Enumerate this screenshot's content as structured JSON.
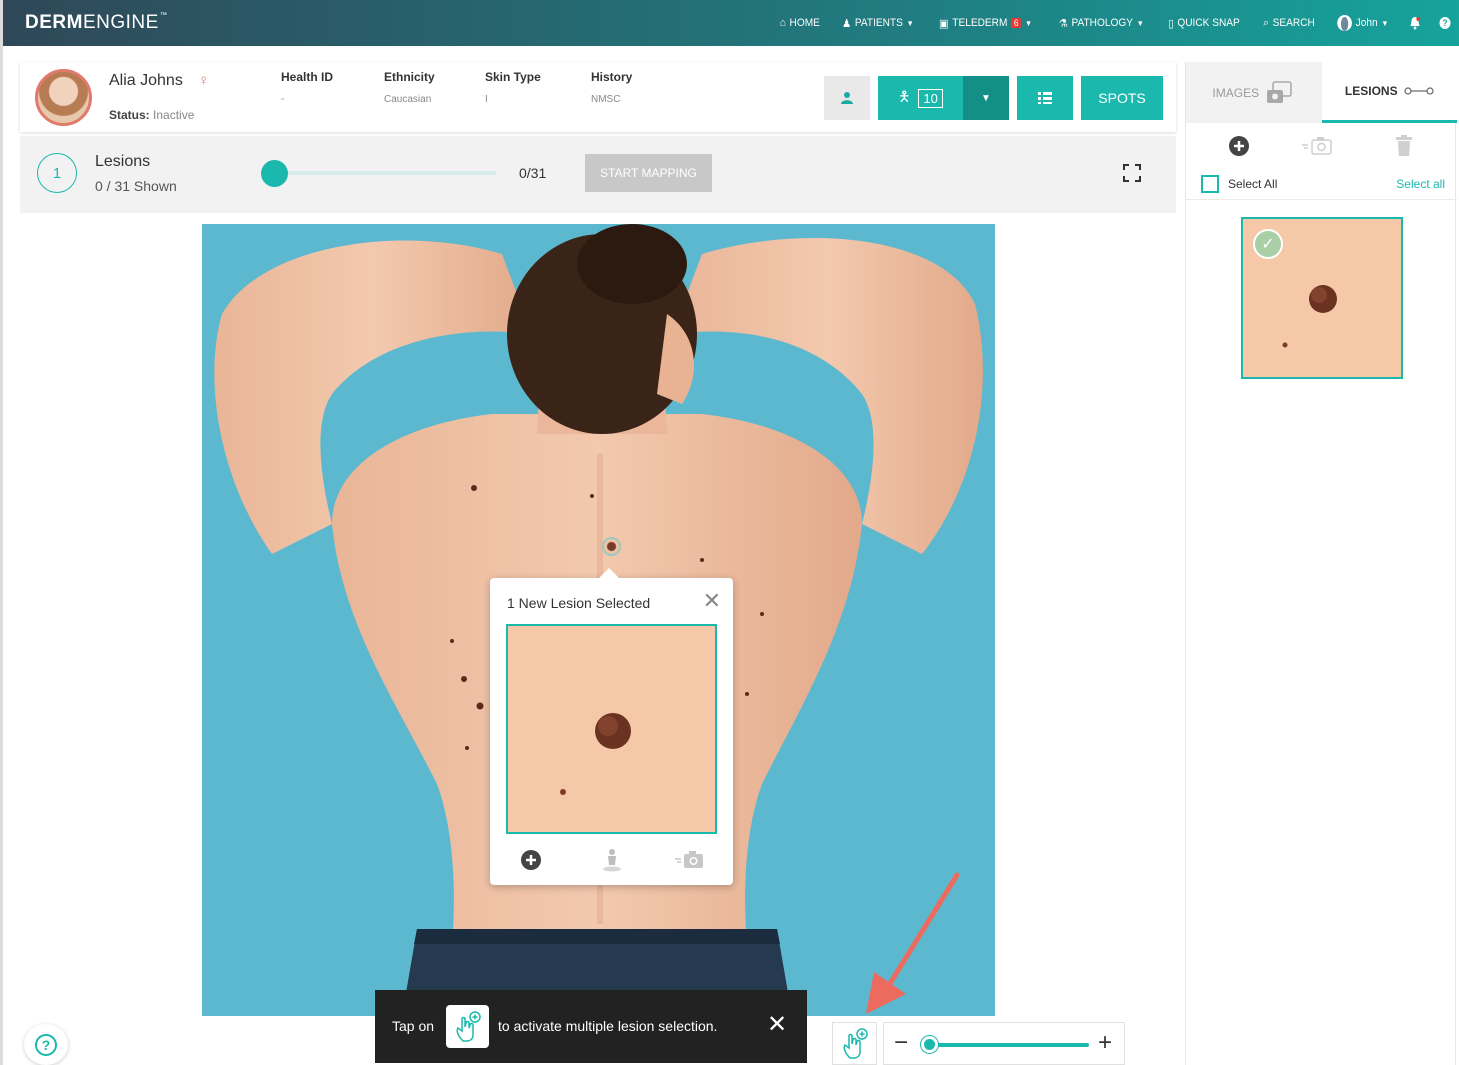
{
  "brand": {
    "bold": "DERM",
    "light": "ENGINE",
    "mark": "™"
  },
  "nav": {
    "home": "HOME",
    "patients": "PATIENTS",
    "telederm": "TELEDERM",
    "telederm_badge": "6",
    "pathology": "PATHOLOGY",
    "quick_snap": "QUICK SNAP",
    "search": "SEARCH",
    "user": "John"
  },
  "patient": {
    "name": "Alia Johns",
    "status_label": "Status:",
    "status_value": "Inactive",
    "health_id_label": "Health ID",
    "health_id_value": "-",
    "ethnicity_label": "Ethnicity",
    "ethnicity_value": "Caucasian",
    "skin_type_label": "Skin Type",
    "skin_type_value": "I",
    "history_label": "History",
    "history_value": "NMSC"
  },
  "toolbar": {
    "body_count": "10",
    "spots_label": "SPOTS"
  },
  "lesions": {
    "step": "1",
    "title": "Lesions",
    "shown": "0 / 31 Shown",
    "count": "0/31",
    "slider_fraction": 0,
    "start_mapping": "START MAPPING"
  },
  "right_panel": {
    "tab_images": "IMAGES",
    "tab_lesions": "LESIONS",
    "select_all_label": "Select All",
    "select_all_link": "Select all"
  },
  "popup": {
    "title": "1 New Lesion Selected"
  },
  "toast": {
    "before": "Tap on",
    "after": "to activate multiple lesion selection."
  },
  "colors": {
    "accent": "#1ab8ad",
    "accent_dark": "#138f87",
    "nav_start": "#2f4858",
    "nav_end": "#16a39c",
    "photo_bg": "#5cb8cf",
    "skin": "#f5c9a8",
    "annotation_arrow": "#ec6a5e"
  }
}
